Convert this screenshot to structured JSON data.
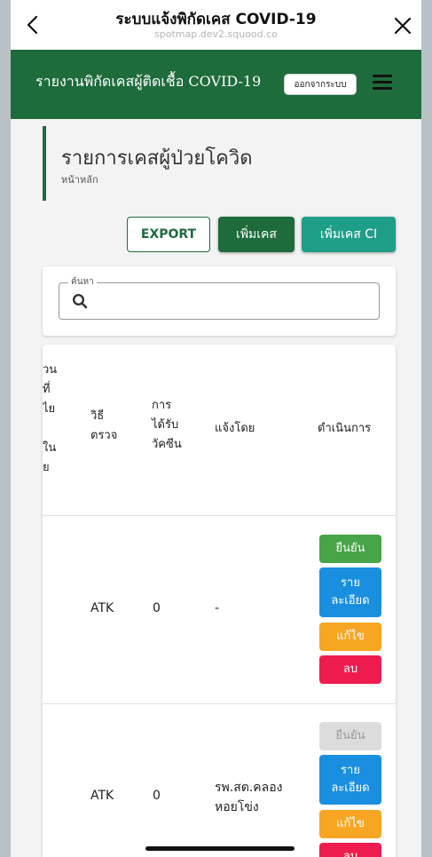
{
  "browser": {
    "title": "ระบบแจ้งพิกัดเคส COVID-19",
    "url": "spotmap.dev2.squood.co"
  },
  "header": {
    "brand": "รายงานพิกัดเคสผู้ติดเชื้อ COVID-19",
    "logout_label": "ออกจากระบบ",
    "color": "#1e6b3c"
  },
  "page": {
    "title": "รายการเคสผู้ป่วยโควิด",
    "breadcrumb": "หน้าหลัก"
  },
  "toolbar": {
    "export_label": "EXPORT",
    "add_label": "เพิ่มเคส",
    "add_ci_label": "เพิ่มเคส CI"
  },
  "search": {
    "label": "ค้นหา",
    "value": ""
  },
  "table": {
    "partial_header": [
      "วน",
      "ที่",
      "ไย",
      "ใน",
      "ย"
    ],
    "columns": [
      "วิธี\nตรวจ",
      "การ\nได้รับ\nวัคซีน",
      "แจ้งโดย",
      "ดำเนินการ"
    ],
    "rows": [
      {
        "method": "ATK",
        "vaccine": "0",
        "reported_by": "-",
        "actions": {
          "confirm": "ยืนยัน",
          "detail": "ราย\nละเอียด",
          "edit": "แก้ไข",
          "delete": "ลบ"
        },
        "confirm_enabled": true
      },
      {
        "method": "ATK",
        "vaccine": "0",
        "reported_by": "รพ.สต.คลอง\nหอยโข่ง",
        "actions": {
          "confirm": "ยืนยัน",
          "detail": "ราย\nละเอียด",
          "edit": "แก้ไข",
          "delete": "ลบ"
        },
        "confirm_enabled": false
      }
    ]
  }
}
